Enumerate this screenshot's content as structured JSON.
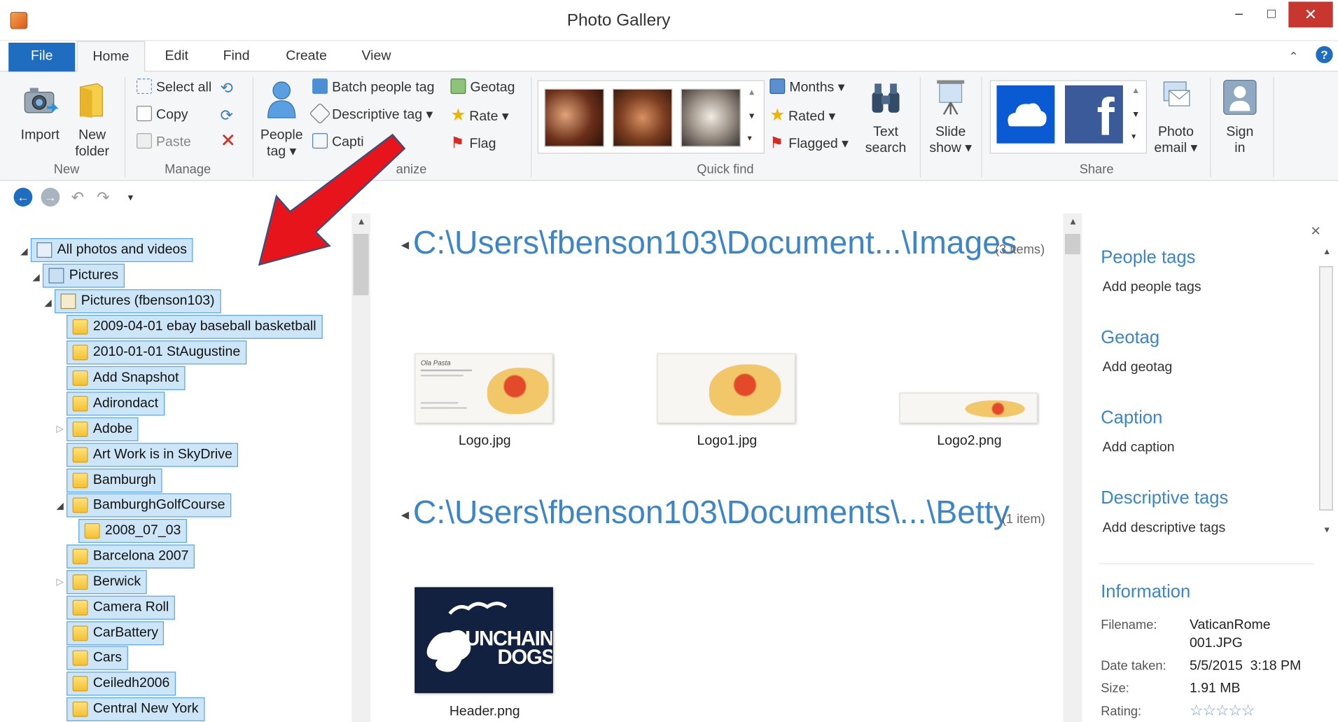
{
  "window": {
    "title": "Photo Gallery",
    "minimize": "–",
    "maximize": "□",
    "close": "✕"
  },
  "tabs": [
    {
      "label": "File"
    },
    {
      "label": "Home"
    },
    {
      "label": "Edit"
    },
    {
      "label": "Find"
    },
    {
      "label": "Create"
    },
    {
      "label": "View"
    }
  ],
  "ribbon": {
    "new": {
      "label": "New",
      "import": "Import",
      "new_folder_1": "New",
      "new_folder_2": "folder"
    },
    "manage": {
      "label": "Manage",
      "select_all": "Select all",
      "copy": "Copy",
      "paste": "Paste"
    },
    "organize": {
      "label": "Organize",
      "label_visible": "anize",
      "people_tag_1": "People",
      "people_tag_2": "tag ▾",
      "batch_people_tag": "Batch people tag",
      "descriptive_tag": "Descriptive tag ▾",
      "caption": "Capti",
      "geotag": "Geotag",
      "rate": "Rate ▾",
      "flag": "Flag"
    },
    "quick_find": {
      "label": "Quick find",
      "months": "Months ▾",
      "rated": "Rated ▾",
      "flagged": "Flagged ▾",
      "text_search_1": "Text",
      "text_search_2": "search",
      "slide_show_1": "Slide",
      "slide_show_2": "show ▾"
    },
    "share": {
      "label": "Share",
      "photo_email_1": "Photo",
      "photo_email_2": "email ▾",
      "sign_in_1": "Sign",
      "sign_in_2": "in"
    }
  },
  "tree": [
    {
      "label": "All photos and videos"
    },
    {
      "label": "Pictures"
    },
    {
      "label": "Pictures (fbenson103)"
    },
    {
      "label": "2009-04-01 ebay baseball basketball"
    },
    {
      "label": "2010-01-01 StAugustine"
    },
    {
      "label": "Add Snapshot"
    },
    {
      "label": "Adirondact"
    },
    {
      "label": "Adobe"
    },
    {
      "label": "Art Work is in SkyDrive"
    },
    {
      "label": "Bamburgh"
    },
    {
      "label": "BamburghGolfCourse"
    },
    {
      "label": "2008_07_03"
    },
    {
      "label": "Barcelona 2007"
    },
    {
      "label": "Berwick"
    },
    {
      "label": "Camera Roll"
    },
    {
      "label": "CarBattery"
    },
    {
      "label": "Cars"
    },
    {
      "label": "Ceiledh2006"
    },
    {
      "label": "Central New York"
    }
  ],
  "groups": [
    {
      "path": "C:\\Users\\fbenson103\\Document...\\Images",
      "count": "(3 items)",
      "files": [
        {
          "name": "Logo.jpg"
        },
        {
          "name": "Logo1.jpg"
        },
        {
          "name": "Logo2.png"
        }
      ]
    },
    {
      "path": "C:\\Users\\fbenson103\\Documents\\...\\Betty",
      "count": "(1 item)",
      "files": [
        {
          "name": "Header.png"
        }
      ]
    }
  ],
  "thumb_text": {
    "logo_title": "Ola Pasta",
    "header_line1": "UNCHAIN",
    "header_line2": "DOGS"
  },
  "panel": {
    "people_tags": "People tags",
    "add_people_tags": "Add people tags",
    "geotag": "Geotag",
    "add_geotag": "Add geotag",
    "caption": "Caption",
    "add_caption": "Add caption",
    "descriptive_tags": "Descriptive tags",
    "add_descriptive_tags": "Add descriptive tags",
    "information": "Information",
    "filename_label": "Filename:",
    "filename_value_1": "VaticanRome",
    "filename_value_2": "001.JPG",
    "date_label": "Date taken:",
    "date_value": "5/5/2015  3:18 PM",
    "size_label": "Size:",
    "size_value": "1.91 MB",
    "rating_label": "Rating:",
    "rating_value": "☆☆☆☆☆",
    "close": "×"
  },
  "colors": {
    "accent": "#1e6dc1",
    "heading": "#3c86c7",
    "selection": "#cde6f7",
    "arrow": "#e8141b",
    "close": "#c7372f"
  }
}
